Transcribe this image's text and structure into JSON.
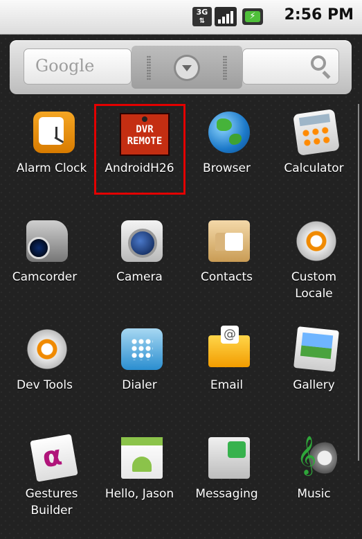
{
  "status_bar": {
    "network": "3G",
    "time": "2:56 PM"
  },
  "search_widget": {
    "logo_text": "Google"
  },
  "apps": [
    {
      "label": "Alarm Clock"
    },
    {
      "label": "AndroidH26",
      "icon_lines": [
        "DVR",
        "REMOTE"
      ],
      "selected": true
    },
    {
      "label": "Browser"
    },
    {
      "label": "Calculator"
    },
    {
      "label": "Camcorder"
    },
    {
      "label": "Camera"
    },
    {
      "label": "Contacts"
    },
    {
      "label": "Custom Locale"
    },
    {
      "label": "Dev Tools"
    },
    {
      "label": "Dialer"
    },
    {
      "label": "Email"
    },
    {
      "label": "Gallery"
    },
    {
      "label": "Gestures Builder"
    },
    {
      "label": "Hello, Jason"
    },
    {
      "label": "Messaging"
    },
    {
      "label": "Music"
    }
  ]
}
